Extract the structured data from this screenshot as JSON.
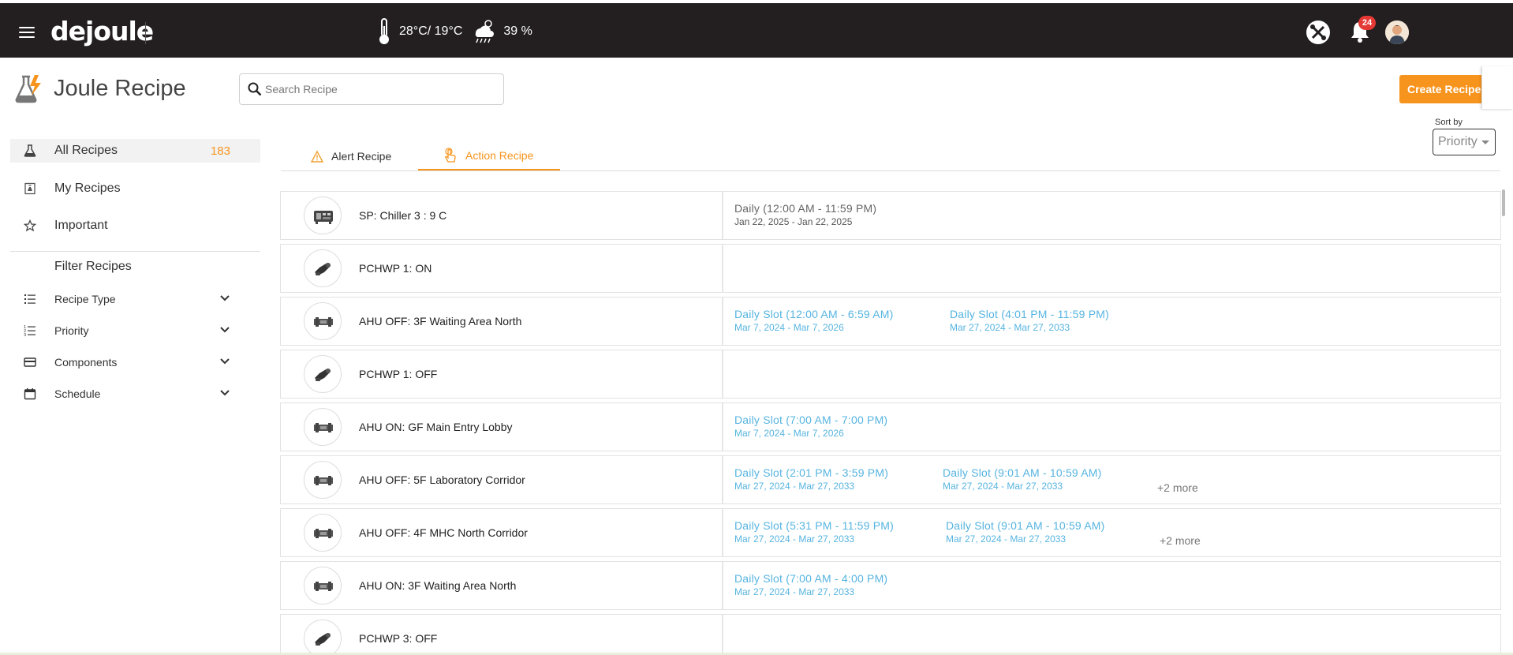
{
  "app": {
    "logo": "dejoule",
    "weather": {
      "temperature": "28°C/ 19°C",
      "humidity": "39 %"
    },
    "notifications_count": "24"
  },
  "header": {
    "title": "Joule Recipe",
    "search_placeholder": "Search Recipe",
    "create_label": "Create Recipe",
    "sort_label": "Sort by",
    "sort_value": "Priority"
  },
  "sidebar": {
    "items": [
      {
        "label": "All Recipes",
        "count": "183"
      },
      {
        "label": "My Recipes"
      },
      {
        "label": "Important"
      }
    ],
    "filter_title": "Filter Recipes",
    "filters": [
      {
        "label": "Recipe Type"
      },
      {
        "label": "Priority"
      },
      {
        "label": "Components"
      },
      {
        "label": "Schedule"
      }
    ]
  },
  "tabs": [
    {
      "label": "Alert Recipe"
    },
    {
      "label": "Action Recipe"
    }
  ],
  "recipes": [
    {
      "name": "SP: Chiller 3 : 9 C",
      "icon": "chiller-icon",
      "schedules": [
        {
          "title": "Daily (12:00 AM - 11:59 PM)",
          "dates": "Jan 22, 2025 - Jan 22, 2025",
          "style": "plain"
        }
      ]
    },
    {
      "name": "PCHWP 1: ON",
      "icon": "pump-icon",
      "schedules": []
    },
    {
      "name": "AHU OFF: 3F Waiting Area North",
      "icon": "ahu-icon",
      "schedules": [
        {
          "title": "Daily Slot (12:00 AM - 6:59 AM)",
          "dates": "Mar 7, 2024 - Mar 7, 2026",
          "style": "blue"
        },
        {
          "title": "Daily Slot (4:01 PM - 11:59 PM)",
          "dates": "Mar 27, 2024 - Mar 27, 2033",
          "style": "blue"
        }
      ]
    },
    {
      "name": "PCHWP 1: OFF",
      "icon": "pump-icon",
      "schedules": []
    },
    {
      "name": "AHU ON: GF Main Entry Lobby",
      "icon": "ahu-icon",
      "schedules": [
        {
          "title": "Daily Slot (7:00 AM - 7:00 PM)",
          "dates": "Mar 7, 2024 - Mar 7, 2026",
          "style": "blue"
        }
      ]
    },
    {
      "name": "AHU OFF: 5F Laboratory Corridor",
      "icon": "ahu-icon",
      "schedules": [
        {
          "title": "Daily Slot (2:01 PM - 3:59 PM)",
          "dates": "Mar 27, 2024 - Mar 27, 2033",
          "style": "blue"
        },
        {
          "title": "Daily Slot (9:01 AM - 10:59 AM)",
          "dates": "Mar 27, 2024 - Mar 27, 2033",
          "style": "blue"
        }
      ],
      "more": "+2 more"
    },
    {
      "name": "AHU OFF: 4F MHC North Corridor",
      "icon": "ahu-icon",
      "schedules": [
        {
          "title": "Daily Slot (5:31 PM - 11:59 PM)",
          "dates": "Mar 27, 2024 - Mar 27, 2033",
          "style": "blue"
        },
        {
          "title": "Daily Slot (9:01 AM - 10:59 AM)",
          "dates": "Mar 27, 2024 - Mar 27, 2033",
          "style": "blue"
        }
      ],
      "more": "+2 more"
    },
    {
      "name": "AHU ON: 3F Waiting Area North",
      "icon": "ahu-icon",
      "schedules": [
        {
          "title": "Daily Slot (7:00 AM - 4:00 PM)",
          "dates": "Mar 27, 2024 - Mar 27, 2033",
          "style": "blue"
        }
      ]
    },
    {
      "name": "PCHWP 3: OFF",
      "icon": "pump-icon",
      "schedules": []
    }
  ]
}
